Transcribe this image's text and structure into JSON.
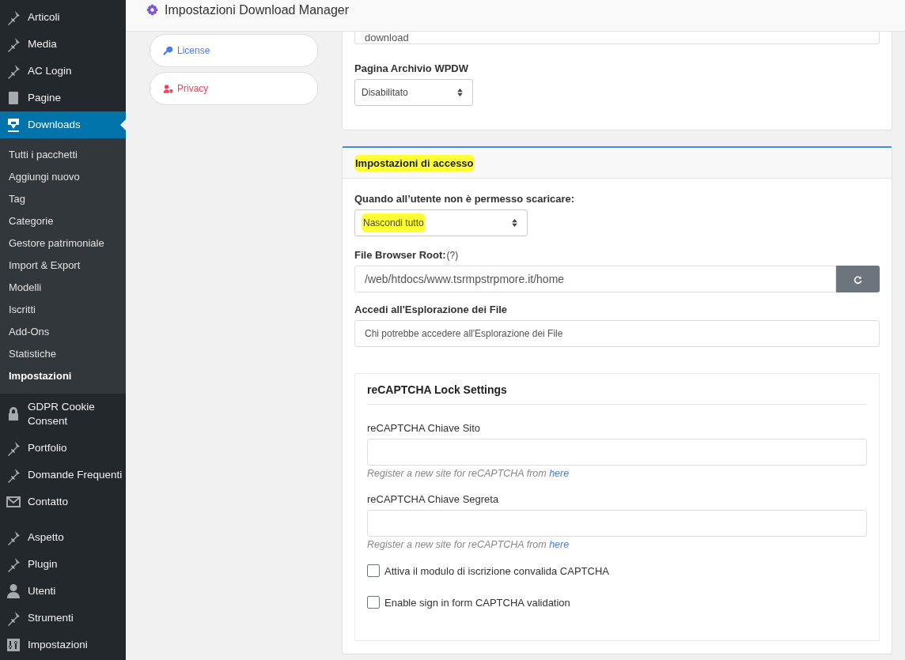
{
  "sidebar": {
    "items": [
      {
        "label": "Articoli",
        "selected": false
      },
      {
        "label": "Media",
        "selected": false
      },
      {
        "label": "AC Login",
        "selected": false
      },
      {
        "label": "Pagine",
        "selected": false
      },
      {
        "label": "Downloads",
        "selected": true,
        "children": [
          {
            "label": "Tutti i pacchetti",
            "selected": false
          },
          {
            "label": "Aggiungi nuovo",
            "selected": false
          },
          {
            "label": "Tag",
            "selected": false
          },
          {
            "label": "Categorie",
            "selected": false
          },
          {
            "label": "Gestore patrimoniale",
            "selected": false
          },
          {
            "label": "Import & Export",
            "selected": false
          },
          {
            "label": "Modelli",
            "selected": false
          },
          {
            "label": "Iscritti",
            "selected": false
          },
          {
            "label": "Add-Ons",
            "selected": false
          },
          {
            "label": "Statistiche",
            "selected": false
          },
          {
            "label": "Impostazioni",
            "selected": true
          }
        ]
      },
      {
        "label": "GDPR Cookie Consent",
        "selected": false
      },
      {
        "label": "Portfolio",
        "selected": false
      },
      {
        "label": "Domande Frequenti",
        "selected": false
      },
      {
        "label": "Contatto",
        "selected": false
      },
      {
        "label": "Aspetto",
        "selected": false
      },
      {
        "label": "Plugin",
        "selected": false
      },
      {
        "label": "Utenti",
        "selected": false
      },
      {
        "label": "Strumenti",
        "selected": false
      },
      {
        "label": "Impostazioni",
        "selected": false
      }
    ]
  },
  "header": {
    "title": "Impostazioni Download Manager"
  },
  "settings_nav": [
    {
      "label": "License",
      "color": "#4a7cf0"
    },
    {
      "label": "Privacy",
      "color": "#f0435a"
    }
  ],
  "general_panel": {
    "slug_field": {
      "value": "download"
    },
    "archive_label": "Pagina Archivio WPDW",
    "archive_select": {
      "value": "Disabilitato"
    }
  },
  "access_panel": {
    "title": "Impostazioni di accesso",
    "denied_label": "Quando all’utente non è permesso scaricare:",
    "denied_select": {
      "value": "Nascondi tutto"
    },
    "root_label": "File Browser Root:",
    "root_help": "(?)",
    "root_field": {
      "value": "/web/htdocs/www.tsrmpstrpmore.it/home"
    },
    "explorer_label": "Accedi all'Esplorazione dei File",
    "explorer_field": {
      "placeholder": "Chi potrebbe accedere all'Esplorazione dei File"
    },
    "recaptcha": {
      "title": "reCAPTCHA Lock Settings",
      "fields": [
        {
          "label": "reCAPTCHA Chiave Sito",
          "hint": "Register a new site for reCAPTCHA from",
          "link": "here"
        },
        {
          "label": "reCAPTCHA Chiave Segreta",
          "hint": "Register a new site for reCAPTCHA from",
          "link": "here"
        }
      ],
      "checkboxes": [
        {
          "label": "Attiva il modulo di iscrizione convalida CAPTCHA",
          "checked": false
        },
        {
          "label": "Enable sign in form CAPTCHA validation",
          "checked": false
        }
      ]
    }
  }
}
